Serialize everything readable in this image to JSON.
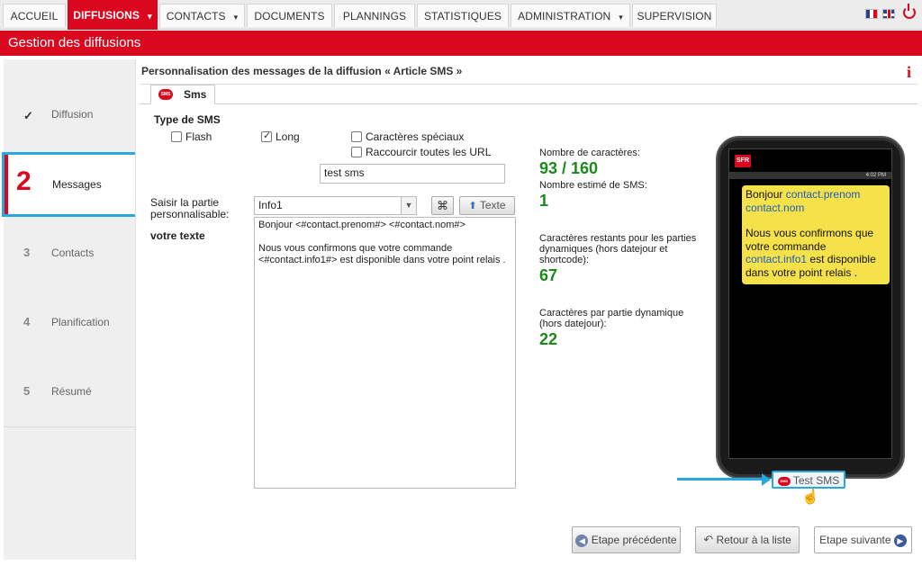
{
  "nav": {
    "items": [
      {
        "label": "ACCUEIL"
      },
      {
        "label": "DIFFUSIONS"
      },
      {
        "label": "CONTACTS"
      },
      {
        "label": "DOCUMENTS"
      },
      {
        "label": "PLANNINGS"
      },
      {
        "label": "STATISTIQUES"
      },
      {
        "label": "ADMINISTRATION"
      },
      {
        "label": "SUPERVISION"
      }
    ],
    "caret": "▾",
    "active_color": "#d9081e"
  },
  "page_title": "Gestion des diffusions",
  "steps": [
    {
      "num": "✓",
      "label": "Diffusion"
    },
    {
      "num": "2",
      "label": "Messages"
    },
    {
      "num": "3",
      "label": "Contacts"
    },
    {
      "num": "4",
      "label": "Planification"
    },
    {
      "num": "5",
      "label": "Résumé"
    }
  ],
  "panel": {
    "title": "Personnalisation des messages de la diffusion « Article SMS »",
    "info_icon": "i",
    "tab_label": "Sms",
    "sms_badge": "SMS"
  },
  "form": {
    "type_heading": "Type de SMS",
    "flash_label": "Flash",
    "long_label": "Long",
    "special_chars_label": "Caractères spéciaux",
    "shorten_urls_label": "Raccourcir toutes les URL",
    "test_value": "test sms",
    "custom_part_label": "Saisir la partie personnalisable:",
    "custom_part_value": "Info1",
    "texte_button": "Texte",
    "your_text_label": "votre texte",
    "message_line1": "Bonjour <#contact.prenom#> <#contact.nom#>",
    "message_line2": "Nous vous confirmons que votre commande <#contact.info1#> est disponible dans votre point relais ."
  },
  "stats": {
    "char_count_label": "Nombre de caractères:",
    "char_count_value": "93 / 160",
    "sms_count_label": "Nombre estimé de SMS:",
    "sms_count_value": "1",
    "remaining_label": "Caractères restants pour les parties dynamiques (hors datejour et shortcode):",
    "remaining_value": "67",
    "per_part_label": "Caractères par partie dynamique (hors datejour):",
    "per_part_value": "22"
  },
  "phone": {
    "brand": "SFR",
    "clock": "4:02 PM",
    "bubble_text1": "Bonjour",
    "bubble_var1": "contact.prenom",
    "bubble_var2": "contact.nom",
    "bubble_text2": "Nous vous confirmons que votre commande",
    "bubble_var3": "contact.info1",
    "bubble_text3": "est disponible dans votre point relais .",
    "test_button": "Test SMS"
  },
  "footer": {
    "prev_label": "Etape précédente",
    "back_label": "Retour à la liste",
    "next_label": "Etape suivante"
  }
}
